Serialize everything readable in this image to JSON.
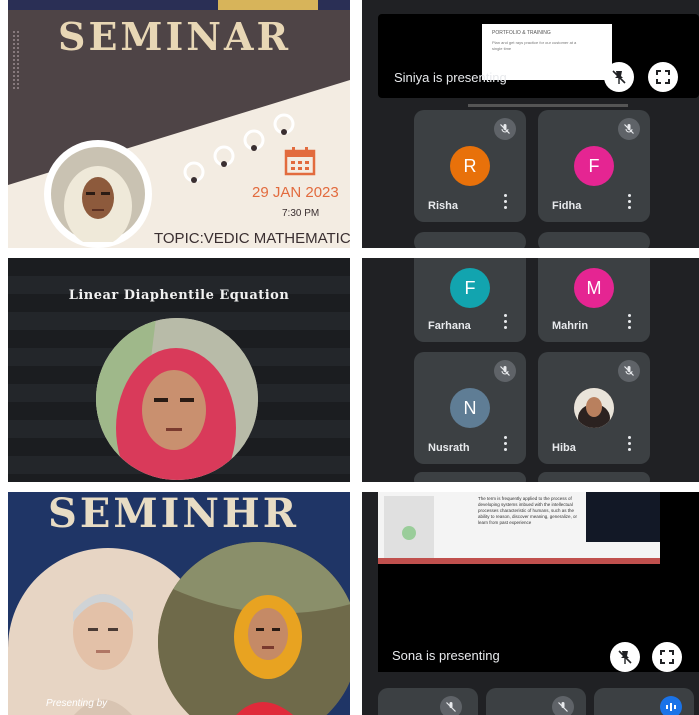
{
  "panel1": {
    "title": "SEMINAR",
    "date": "29 JAN 2023",
    "time": "7:30 PM",
    "topic": "TOPIC:VEDIC MATHEMATICS",
    "accent": "#e26b3e"
  },
  "panel2": {
    "presenting": "Siniya is presenting",
    "slide_heading": "PORTFOLIO & TRAINING",
    "slide_text": "Plan and get rays practice for our customer at a single time",
    "participants": [
      {
        "name": "Risha",
        "initial": "R",
        "color": "#e8710a"
      },
      {
        "name": "Fidha",
        "initial": "F",
        "color": "#e52592"
      }
    ]
  },
  "panel3": {
    "title": "Linear Diaphentile Equation"
  },
  "panel4": {
    "participants": [
      {
        "name": "Farhana",
        "initial": "F",
        "color": "#12a4af"
      },
      {
        "name": "Mahrin",
        "initial": "M",
        "color": "#e52592"
      },
      {
        "name": "Nusrath",
        "initial": "N",
        "color": "#5f7d95"
      },
      {
        "name": "Hiba",
        "initial": "",
        "color": "#8d6e63"
      }
    ]
  },
  "panel5": {
    "title": "SEMINHR",
    "footer": "Presenting by"
  },
  "panel6": {
    "presenting": "Sona is presenting",
    "slide_text": "The term is frequently applied to the process of developing systems imbued with the intellectual processes characteristic of humans, such as the ability to reason, discover meaning, generalize, or learn from past experience"
  }
}
